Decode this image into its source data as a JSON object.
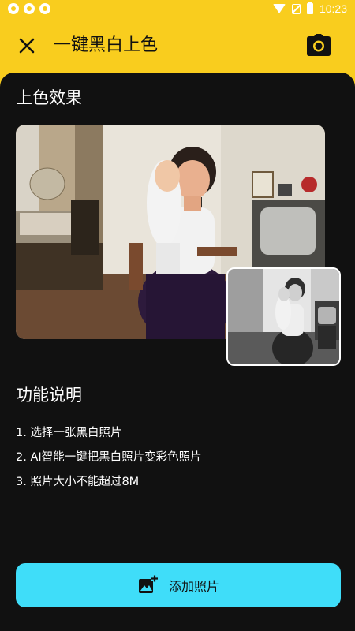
{
  "status_bar": {
    "time": "10:23"
  },
  "app_bar": {
    "title": "一键黑白上色"
  },
  "result": {
    "title": "上色效果"
  },
  "function": {
    "title": "功能说明",
    "steps": [
      "1. 选择一张黑白照片",
      "2. AI智能一键把黑白照片变彩色照片",
      "3. 照片大小不能超过8M"
    ]
  },
  "add_button": {
    "label": "添加照片"
  },
  "colors": {
    "accent_yellow": "#F9CD1E",
    "panel_dark": "#111111",
    "button_cyan": "#3FDDF9"
  },
  "icons": {
    "close": "close-icon",
    "camera": "camera-icon",
    "add_photo": "add-photo-icon"
  }
}
